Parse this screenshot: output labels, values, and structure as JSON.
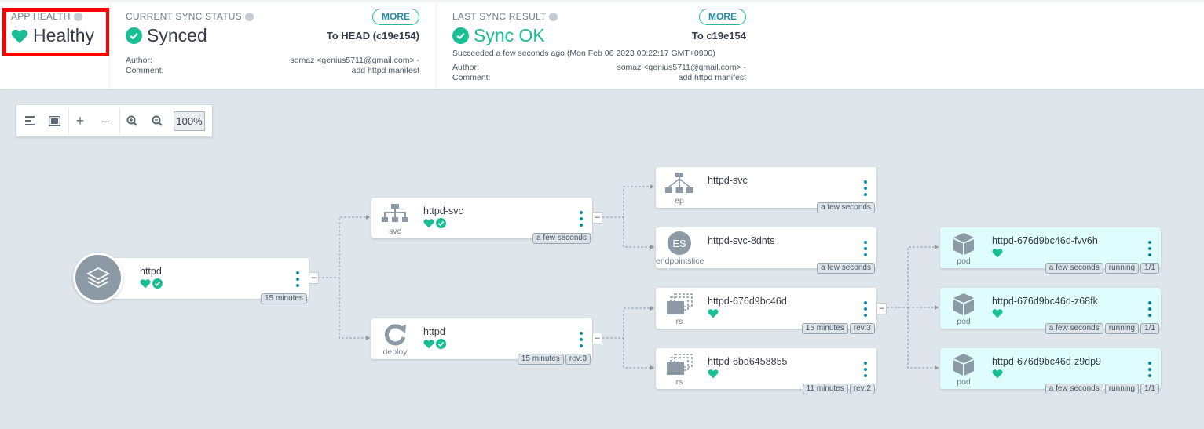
{
  "app_health": {
    "heading": "APP HEALTH",
    "status": "Healthy"
  },
  "current_sync": {
    "heading": "CURRENT SYNC STATUS",
    "status": "Synced",
    "more_label": "MORE",
    "target": "To HEAD (c19e154)",
    "author_label": "Author:",
    "author_value": "somaz <genius5711@gmail.com> -",
    "comment_label": "Comment:",
    "comment_value": "add httpd manifest"
  },
  "last_sync": {
    "heading": "LAST SYNC RESULT",
    "status": "Sync OK",
    "more_label": "MORE",
    "target": "To c19e154",
    "succeeded": "Succeeded a few seconds ago (Mon Feb 06 2023 00:22:17 GMT+0900)",
    "author_label": "Author:",
    "author_value": "somaz <genius5711@gmail.com> -",
    "comment_label": "Comment:",
    "comment_value": "add httpd manifest"
  },
  "toolbar": {
    "zoom_level": "100%",
    "plus": "+",
    "minus": "–"
  },
  "colors": {
    "healthy_green": "#18be94",
    "pod_background": "#dffdfd",
    "canvas_background": "#dee6eb"
  },
  "nodes": {
    "app": {
      "name": "httpd",
      "tags": [
        "15 minutes"
      ]
    },
    "svc": {
      "name": "httpd-svc",
      "kind": "svc",
      "tags": [
        "a few seconds"
      ]
    },
    "deploy": {
      "name": "httpd",
      "kind": "deploy",
      "tags": [
        "15 minutes",
        "rev:3"
      ]
    },
    "ep": {
      "name": "httpd-svc",
      "kind": "ep",
      "tags": [
        "a few seconds"
      ]
    },
    "es": {
      "name": "httpd-svc-8dnts",
      "kind": "endpointslice",
      "badge": "ES",
      "tags": [
        "a few seconds"
      ]
    },
    "rs1": {
      "name": "httpd-676d9bc46d",
      "kind": "rs",
      "tags": [
        "15 minutes",
        "rev:3"
      ]
    },
    "rs2": {
      "name": "httpd-6bd6458855",
      "kind": "rs",
      "tags": [
        "11 minutes",
        "rev:2"
      ]
    },
    "pod1": {
      "name": "httpd-676d9bc46d-fvv6h",
      "kind": "pod",
      "tags": [
        "a few seconds",
        "running",
        "1/1"
      ]
    },
    "pod2": {
      "name": "httpd-676d9bc46d-z68fk",
      "kind": "pod",
      "tags": [
        "a few seconds",
        "running",
        "1/1"
      ]
    },
    "pod3": {
      "name": "httpd-676d9bc46d-z9dp9",
      "kind": "pod",
      "tags": [
        "a few seconds",
        "running",
        "1/1"
      ]
    }
  },
  "collapse_symbol": "–"
}
